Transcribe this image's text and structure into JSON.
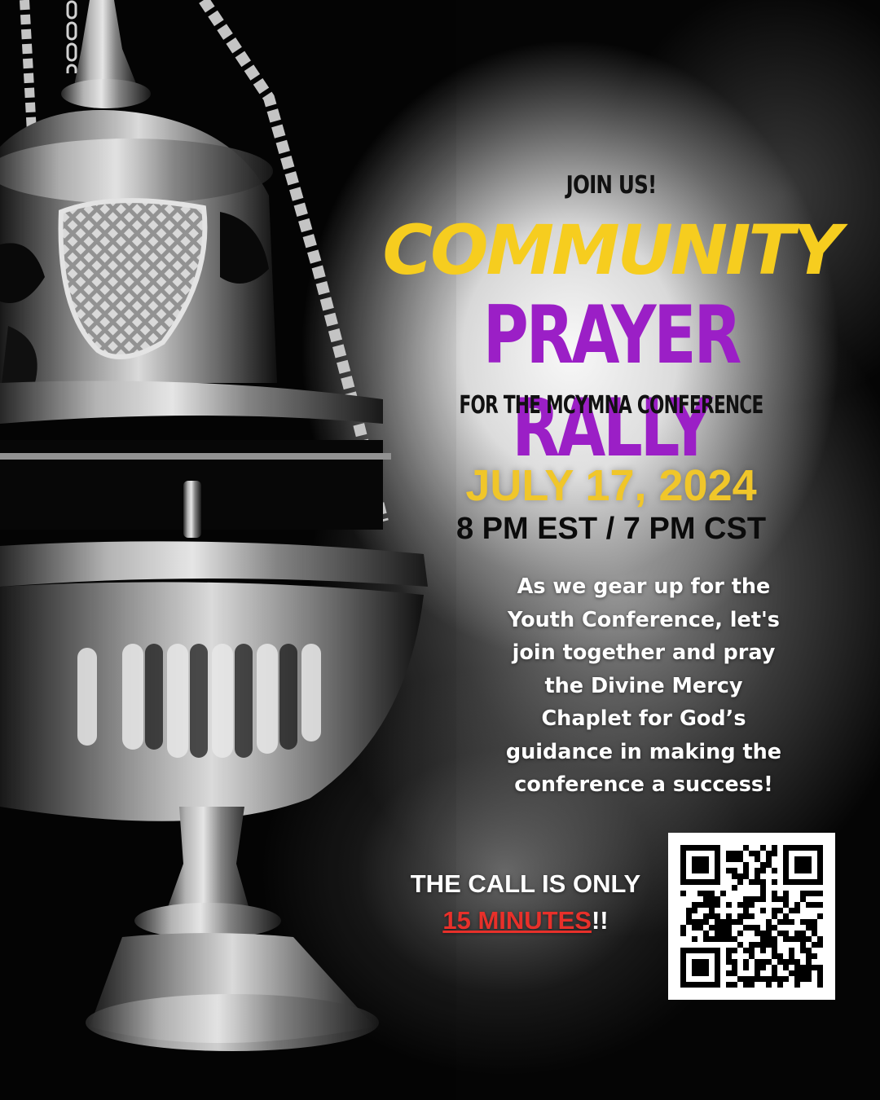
{
  "header": {
    "kicker": "JOIN US!",
    "title_line1": "COMMUNITY",
    "title_line2": "PRAYER RALLY",
    "subtitle": "FOR THE MCYMNA CONFERENCE"
  },
  "event": {
    "date": "JULY 17, 2024",
    "time": "8 PM EST / 7 PM CST"
  },
  "description": {
    "line1": "As we gear up for the",
    "line2": "Youth Conference, let's",
    "line3": "join together and pray",
    "line4": "the Divine Mercy",
    "line5": "Chaplet for God’s",
    "line6": "guidance in making the",
    "line7": "conference a success!"
  },
  "call": {
    "line1": "THE CALL IS ONLY",
    "highlight": "15 MINUTES",
    "suffix": "!!"
  },
  "colors": {
    "yellow": "#f6cd1f",
    "purple": "#9b1fc6",
    "red": "#e8302a"
  },
  "image": {
    "subject": "censer-image",
    "code": "qr-code"
  }
}
